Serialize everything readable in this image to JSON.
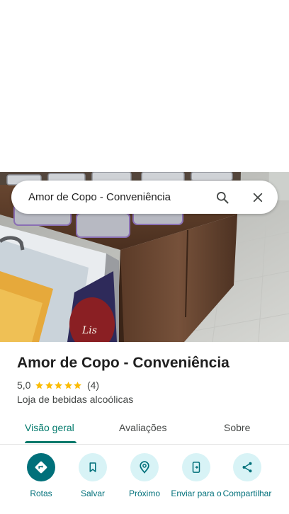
{
  "search": {
    "query": "Amor de Copo - Conveniência"
  },
  "place": {
    "name": "Amor de Copo - Conveniência",
    "rating": "5,0",
    "stars": 5,
    "review_count": "(4)",
    "category": "Loja de bebidas alcoólicas"
  },
  "photo": {
    "sign_text": "Lis"
  },
  "tabs": [
    {
      "label": "Visão geral",
      "active": true
    },
    {
      "label": "Avaliações",
      "active": false
    },
    {
      "label": "Sobre",
      "active": false
    }
  ],
  "actions": [
    {
      "label": "Rotas",
      "icon": "directions-icon"
    },
    {
      "label": "Salvar",
      "icon": "bookmark-icon"
    },
    {
      "label": "Próximo",
      "icon": "nearby-icon"
    },
    {
      "label": "Enviar para o",
      "icon": "send-to-phone-icon"
    },
    {
      "label": "Compartilhar",
      "icon": "share-icon"
    }
  ],
  "colors": {
    "accent": "#00707a",
    "tab_active": "#00796b",
    "star": "#fbbc04",
    "action_bg": "#d8f3f6"
  }
}
